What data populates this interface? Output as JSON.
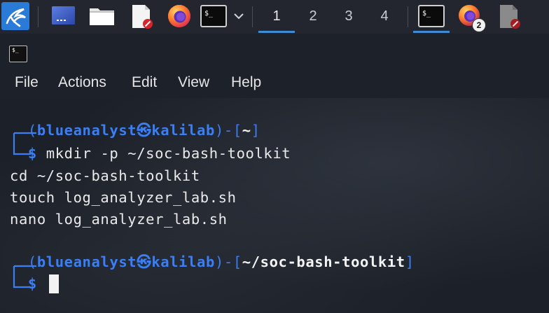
{
  "taskbar": {
    "workspaces": [
      "1",
      "2",
      "3",
      "4"
    ],
    "active_workspace": "1",
    "terminal_icon_text": "$_",
    "firefox_badge": "2",
    "accent_color": "#3e8cd6"
  },
  "terminal": {
    "icon_text": "$_",
    "menu": [
      "File",
      "Actions",
      "Edit",
      "View",
      "Help"
    ],
    "prompt1": {
      "user": "blueanalyst",
      "at_symbol": "㉿",
      "host": "kalilab",
      "dir": "~",
      "command": "mkdir -p ~/soc-bash-toolkit"
    },
    "output_lines": [
      "cd ~/soc-bash-toolkit",
      "touch log_analyzer_lab.sh",
      "nano log_analyzer_lab.sh"
    ],
    "prompt2": {
      "user": "blueanalyst",
      "at_symbol": "㉿",
      "host": "kalilab",
      "dir": "~/soc-bash-toolkit"
    },
    "prompt_symbol": "$",
    "colors": {
      "prompt_blue": "#3a7ff6",
      "text": "#eaeaea",
      "background": "#1c2028"
    }
  }
}
